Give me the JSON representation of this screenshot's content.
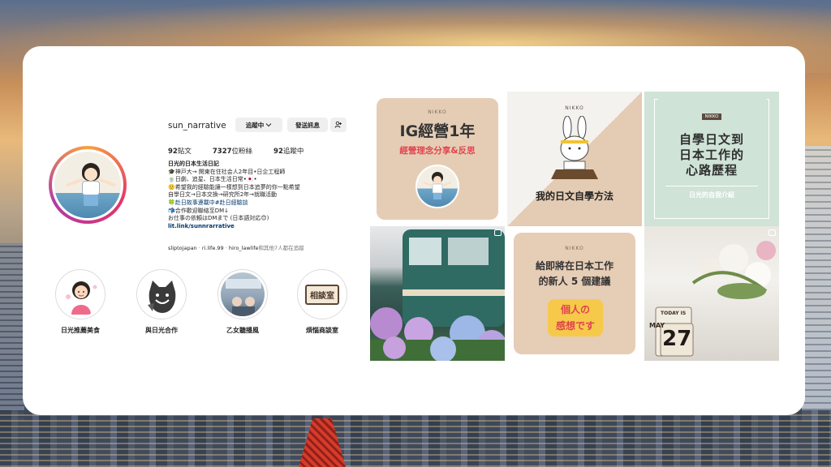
{
  "profile": {
    "username": "sun_narrative",
    "follow_button": "追蹤中",
    "message_button": "發送訊息",
    "add_user_icon": "add-user-icon",
    "stats": {
      "posts": "92",
      "posts_label": "貼文",
      "followers": "7327",
      "followers_label": "位粉絲",
      "following": "92",
      "following_label": "追蹤中"
    },
    "bio": {
      "name": "日光的日本生活日記",
      "lines": [
        "🎓神戸大→ 関東在住社会人2年目•日企工程師",
        "🍵日劇、追星、日本生活日常•🇯🇵•",
        "🙂希望我的經驗能讓一樣想到日本追夢的你一點希望",
        "自學日文→日本交換→研究所2年→就職活動",
        "🍀赴日故事連載中#赴日經驗談",
        "📬合作歡迎聯絡至DM↓",
        "お仕事の依頼はDMまで (日本語対応😊)"
      ],
      "link": "lit.link/sunnrarrative"
    },
    "followed_by": {
      "prefix": "sliptojapan",
      "second": "ri.life.99",
      "third": "hiro_lawlife",
      "suffix": "和其他7人都在追蹤"
    }
  },
  "highlights": [
    {
      "label": "日光推薦美食"
    },
    {
      "label": "與日光合作"
    },
    {
      "label": "乙女聽播風"
    },
    {
      "label": "煩惱商談室"
    }
  ],
  "highlight_text": {
    "consult_room": "相談室"
  },
  "posts": [
    {
      "brand": "NIKKO",
      "title": "IG經營1年",
      "subtitle": "經營理念分享&反思"
    },
    {
      "brand": "NIKKO",
      "title": "我的日文自學方法"
    },
    {
      "brand": "NIKKO",
      "title_lines": [
        "自學日文到",
        "日本工作的",
        "心路歷程"
      ],
      "subtitle": "日光的自我介紹"
    },
    {
      "type": "photo-train"
    },
    {
      "brand": "NIKKO",
      "title_lines": [
        "給即將在日本工作",
        "的新人 5 個建議"
      ],
      "sticker_lines": [
        "個人の",
        "感想です"
      ]
    },
    {
      "type": "photo-flowers",
      "calendar": {
        "top": "TODAY IS",
        "month": "MAY",
        "day": "27"
      }
    }
  ],
  "colors": {
    "accent_red": "#e0444f",
    "beige_tile": "#e9d5c3",
    "mint_tile": "#cfe3d6",
    "ig_link": "#00376b"
  }
}
